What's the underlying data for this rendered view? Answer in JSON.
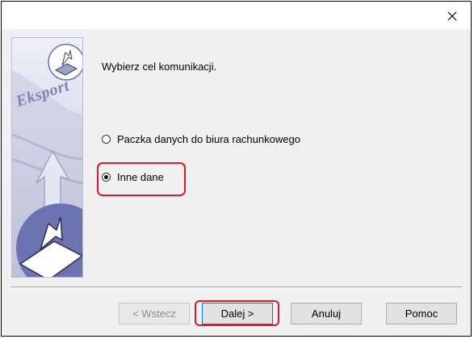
{
  "window": {
    "close_label": "✕"
  },
  "side_panel": {
    "text": "Eksport",
    "icon": "export-wizard-icon"
  },
  "prompt": "Wybierz cel komunikacji.",
  "options": [
    {
      "label": "Paczka danych do biura rachunkowego",
      "selected": false
    },
    {
      "label": "Inne dane",
      "selected": true
    }
  ],
  "buttons": {
    "back": "< Wstecz",
    "next": "Dalej >",
    "cancel": "Anuluj",
    "help": "Pomoc"
  },
  "colors": {
    "highlight": "#e0182f",
    "panel_accent": "#6b73b0"
  }
}
